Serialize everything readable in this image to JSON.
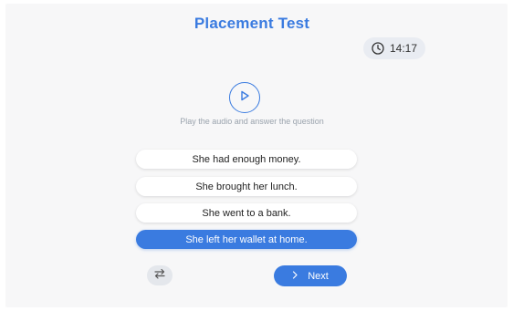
{
  "header": {
    "title": "Placement Test"
  },
  "timer": {
    "icon": "clock-icon",
    "value": "14:17"
  },
  "audio": {
    "play_icon": "play-icon",
    "instruction": "Play the audio and answer the question"
  },
  "options": [
    {
      "label": "She had enough money.",
      "selected": false
    },
    {
      "label": "She brought her lunch.",
      "selected": false
    },
    {
      "label": "She went to a bank.",
      "selected": false
    },
    {
      "label": "She left her wallet at home.",
      "selected": true
    }
  ],
  "footer": {
    "swap_icon": "swap-arrows-icon",
    "next_icon": "chevron-right-icon",
    "next_label": "Next"
  },
  "colors": {
    "accent": "#3a7be0",
    "background": "#f7f7f8",
    "timer_bg": "#e9ecf2"
  }
}
